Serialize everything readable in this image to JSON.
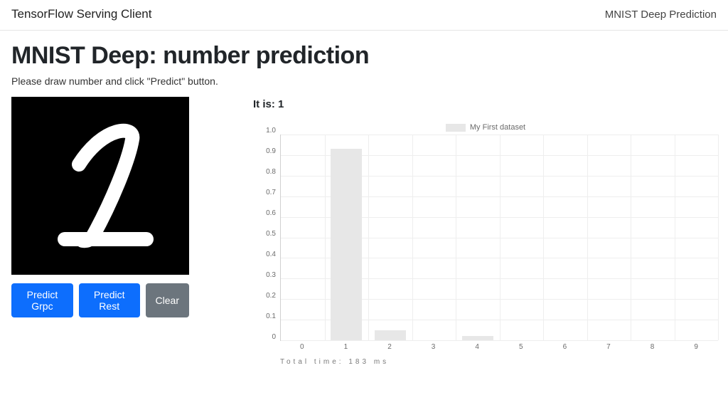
{
  "topbar": {
    "brand": "TensorFlow Serving Client",
    "nav_item": "MNIST Deep Prediction"
  },
  "page": {
    "title": "MNIST Deep: number prediction",
    "instruction": "Please draw number and click \"Predict\" button."
  },
  "buttons": {
    "predict_grpc": "Predict Grpc",
    "predict_rest": "Predict Rest",
    "clear": "Clear"
  },
  "result": {
    "label_prefix": "It is: ",
    "value": "1"
  },
  "total_time": {
    "label": "Total time:",
    "ms": 183,
    "unit": "ms"
  },
  "chart_data": {
    "type": "bar",
    "legend": "My First dataset",
    "categories": [
      "0",
      "1",
      "2",
      "3",
      "4",
      "5",
      "6",
      "7",
      "8",
      "9"
    ],
    "values": [
      0,
      0.93,
      0.05,
      0,
      0.02,
      0,
      0,
      0,
      0,
      0
    ],
    "ylim": [
      0,
      1.0
    ],
    "yticks": [
      1.0,
      0.9,
      0.8,
      0.7,
      0.6,
      0.5,
      0.4,
      0.3,
      0.2,
      0.1,
      0
    ],
    "xlabel": "",
    "ylabel": "",
    "title": ""
  },
  "icons": {
    "drawn_digit": "digit-1"
  }
}
